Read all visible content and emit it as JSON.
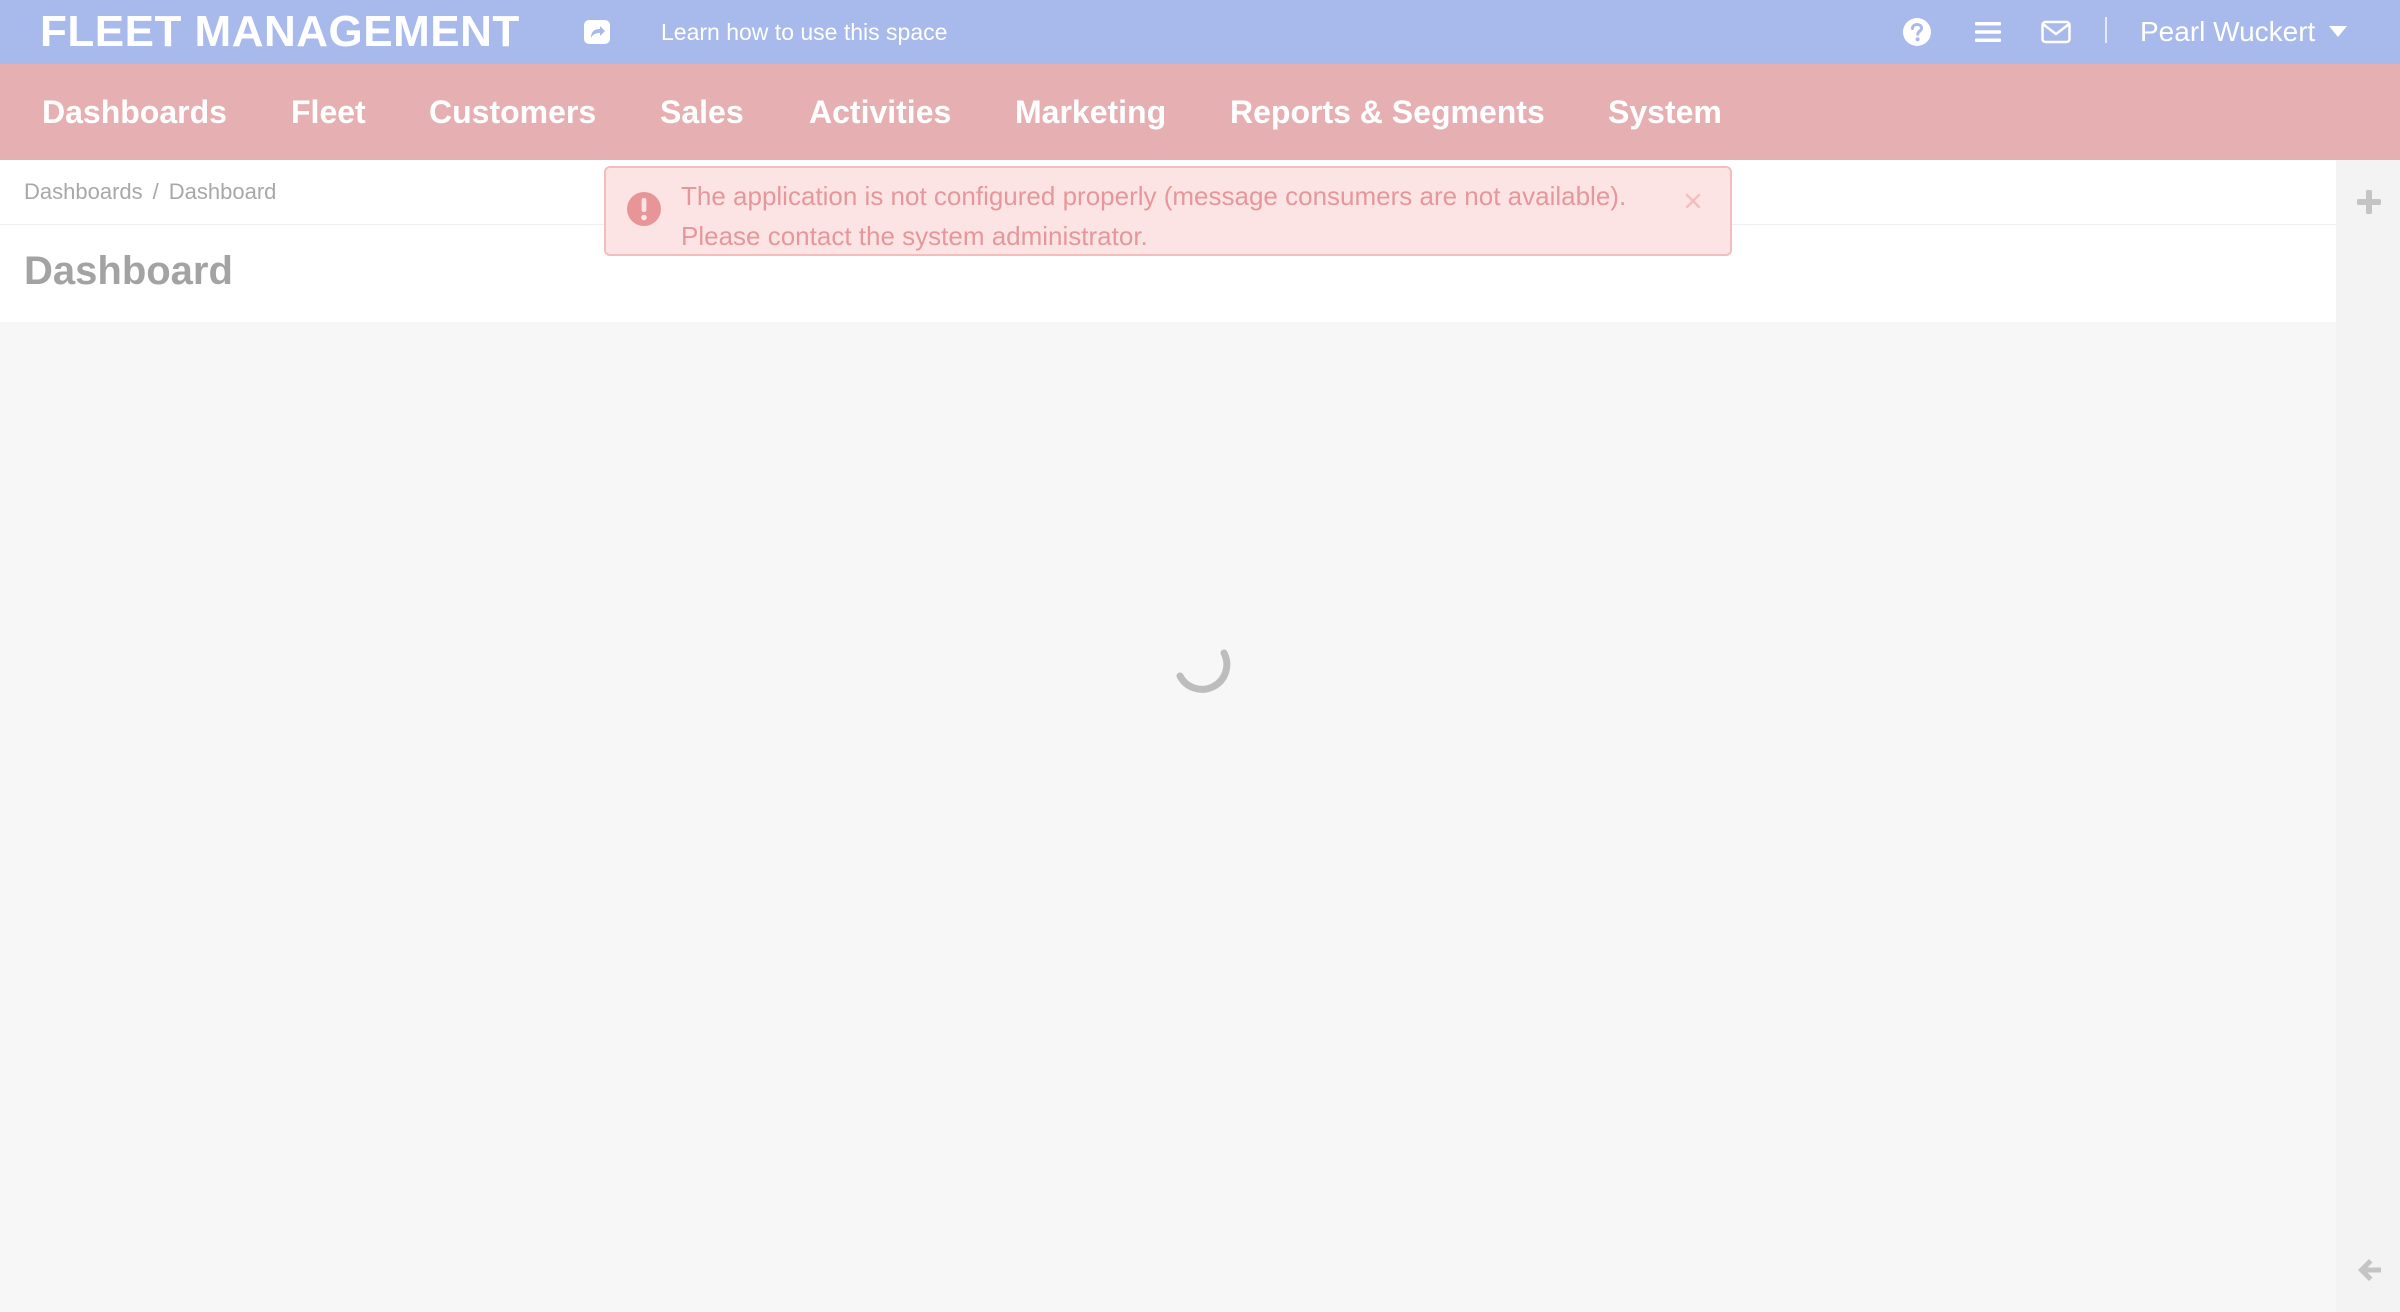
{
  "header": {
    "brand": "FLEET MANAGEMENT",
    "learn_link": "Learn how to use this space",
    "user_name": "Pearl Wuckert",
    "icons": [
      "share-icon",
      "help-icon",
      "menu-icon",
      "mail-icon",
      "caret-down-icon"
    ]
  },
  "nav": {
    "items": [
      {
        "label": "Dashboards"
      },
      {
        "label": "Fleet"
      },
      {
        "label": "Customers"
      },
      {
        "label": "Sales"
      },
      {
        "label": "Activities"
      },
      {
        "label": "Marketing"
      },
      {
        "label": "Reports & Segments"
      },
      {
        "label": "System"
      }
    ]
  },
  "breadcrumb": {
    "items": [
      "Dashboards",
      "Dashboard"
    ],
    "separator": "/"
  },
  "page": {
    "title": "Dashboard"
  },
  "alert": {
    "line1": "The application is not configured properly (message consumers are not available).",
    "line2": "Please contact the system administrator.",
    "icons": [
      "exclamation-icon",
      "close-icon"
    ]
  },
  "rail": {
    "icons": [
      "plus-icon",
      "arrow-left-icon"
    ]
  },
  "loading": {
    "icon": "spinner-icon"
  },
  "colors": {
    "topbar": "#a8b9ec",
    "nav": "#e6b0b3",
    "alert_bg": "#fde4e4",
    "alert_border": "#f3bdbd",
    "alert_text": "#e4989b",
    "background": "#f7f7f7"
  }
}
